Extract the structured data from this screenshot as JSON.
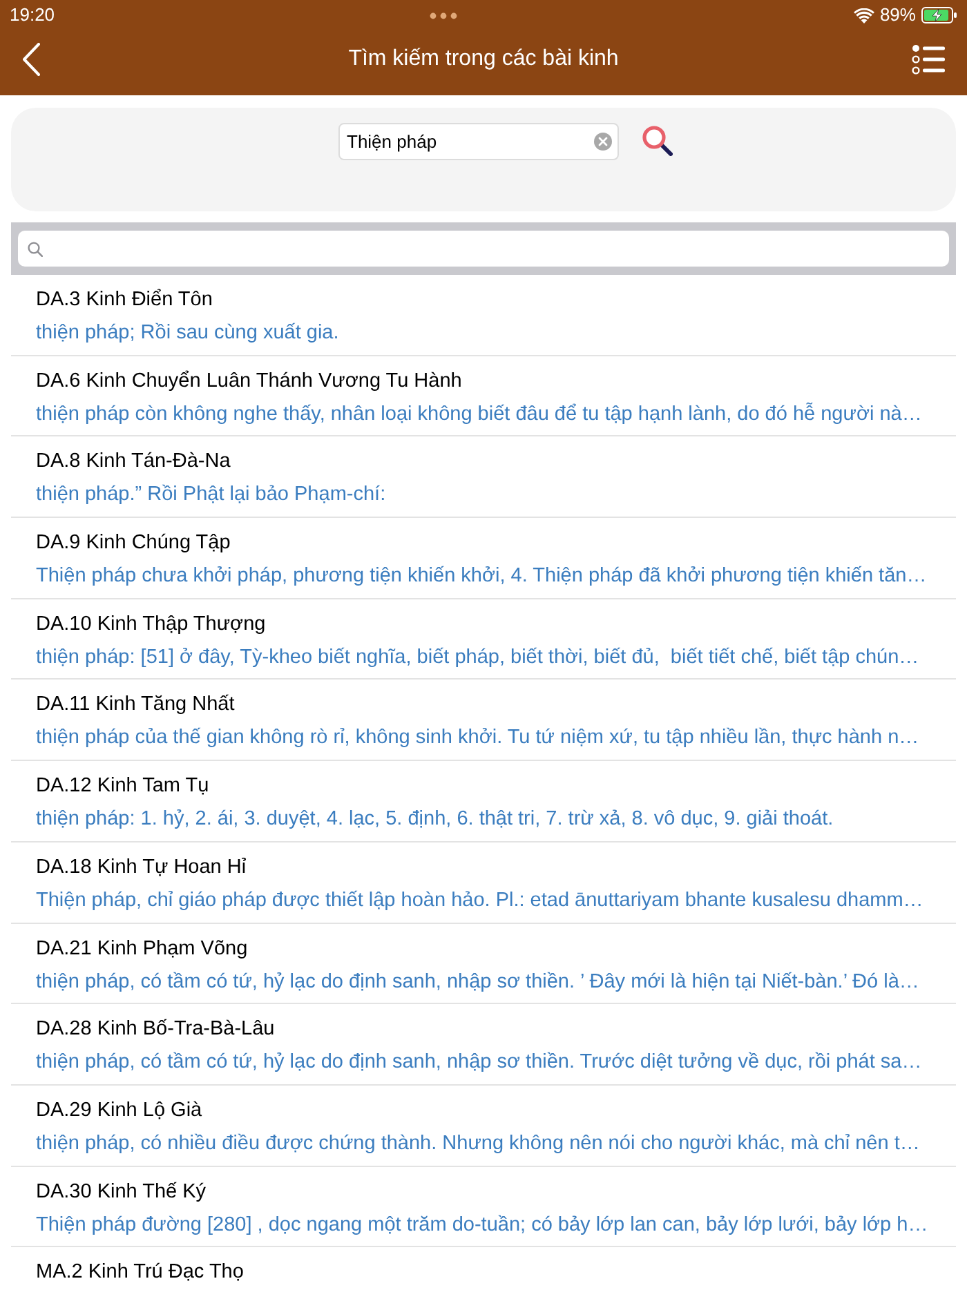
{
  "status_bar": {
    "time": "19:20",
    "battery": "89%"
  },
  "header": {
    "title": "Tìm kiếm trong các bài kinh"
  },
  "search": {
    "value": "Thiện pháp"
  },
  "results": [
    {
      "title": "DA.3 Kinh Điển Tôn",
      "snippet": "thiện pháp; Rồi sau cùng xuất gia."
    },
    {
      "title": "DA.6 Kinh Chuyển Luân Thánh Vương Tu Hành",
      "snippet": "thiện pháp còn không nghe thấy, nhân loại không biết đâu để tu tập hạnh lành, do đó hễ người nà…"
    },
    {
      "title": "DA.8 Kinh Tán-Đà-Na",
      "snippet": "thiện pháp.” Rồi Phật lại bảo Phạm-chí:"
    },
    {
      "title": "DA.9 Kinh Chúng Tập",
      "snippet": "Thiện pháp chưa khởi pháp, phương tiện khiến khởi, 4. Thiện pháp đã khởi phương tiện khiến tăn…"
    },
    {
      "title": "DA.10 Kinh Thập Thượng",
      "snippet": "thiện pháp: [51] ở đây, Tỳ-kheo biết nghĩa, biết pháp, biết thời, biết đủ,  biết tiết chế, biết tập chún…"
    },
    {
      "title": "DA.11 Kinh Tăng Nhất",
      "snippet": "thiện pháp của thế gian không rò rỉ, không sinh khởi. Tu tứ niệm xứ, tu tập nhiều lần, thực hành n…"
    },
    {
      "title": "DA.12 Kinh Tam Tụ",
      "snippet": "thiện pháp: 1. hỷ, 2. ái, 3. duyệt, 4. lạc, 5. định, 6. thật tri, 7. trừ xả, 8. vô dục, 9. giải thoát."
    },
    {
      "title": "DA.18 Kinh Tự Hoan Hỉ",
      "snippet": "Thiện pháp, chỉ giáo pháp được thiết lập hoàn hảo. Pl.: etad ānuttariyam bhante kusalesu dhamm…"
    },
    {
      "title": "DA.21 Kinh Phạm Võng",
      "snippet": "thiện pháp, có tầm có tứ, hỷ lạc do định sanh, nhập sơ thiền. ’ Đây mới là hiện tại Niết-bàn.’ Đó là…"
    },
    {
      "title": "DA.28 Kinh Bố-Tra-Bà-Lâu",
      "snippet": "thiện pháp, có tầm có tứ, hỷ lạc do định sanh, nhập sơ thiền. Trước diệt tưởng về dục, rồi phát sa…"
    },
    {
      "title": "DA.29 Kinh Lộ Già",
      "snippet": "thiện pháp, có nhiều điều được chứng thành. Nhưng không nên nói cho người khác, mà chỉ nên t…"
    },
    {
      "title": "DA.30 Kinh Thế Ký",
      "snippet": "Thiện pháp đường [280] , dọc ngang một trăm do-tuần; có bảy lớp lan can, bảy lớp lưới, bảy lớp h…"
    },
    {
      "title": "MA.2 Kinh Trú Đạc Thọ"
    }
  ]
}
